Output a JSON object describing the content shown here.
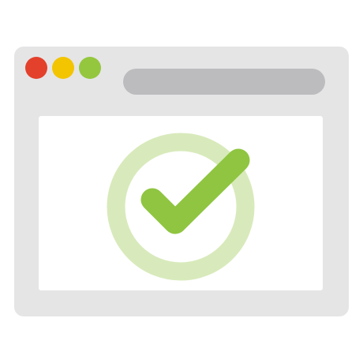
{
  "colors": {
    "window_frame": "#e5e5e6",
    "address_bar": "#bcbcbe",
    "content_background": "#ffffff",
    "dot_red": "#e3412b",
    "dot_yellow": "#f3c400",
    "dot_green": "#94c73d",
    "check_ring": "#d8eabb",
    "check_mark": "#8fc540"
  },
  "icons": {
    "window": "browser-window-icon",
    "status": "checkmark-icon",
    "status_ring": "success-ring-icon"
  }
}
